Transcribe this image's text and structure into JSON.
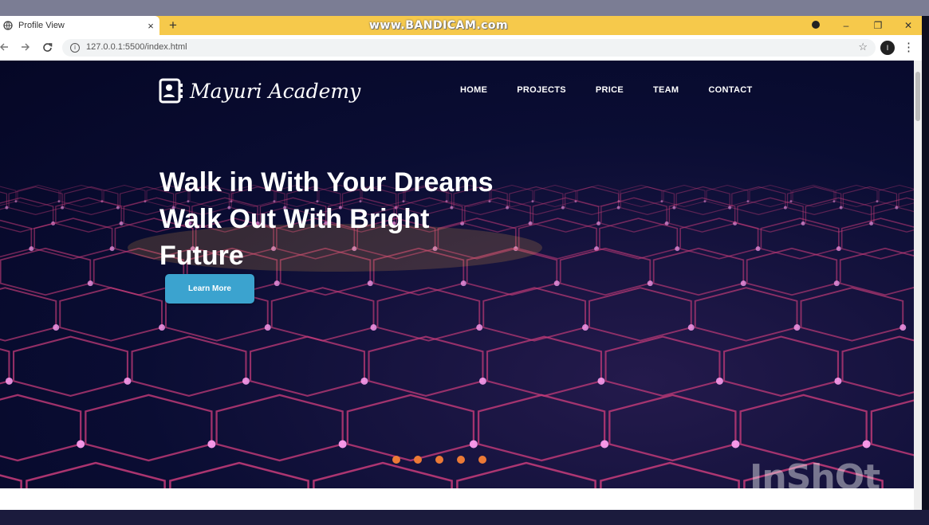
{
  "browser": {
    "tab_title": "Profile View",
    "tab_close": "×",
    "new_tab": "+",
    "url": "127.0.0.1:5500/index.html",
    "recorder_watermark": "www.BANDICAM.com",
    "window_controls": {
      "minimize": "–",
      "restore": "❐",
      "close": "✕"
    },
    "account_initial": "I",
    "menu": "⋮",
    "icons": {
      "back": "back-arrow-icon",
      "forward": "forward-arrow-icon",
      "reload": "reload-icon",
      "site_info": "info-icon",
      "bookmark": "star-icon",
      "menu": "menu-dots-icon"
    }
  },
  "site": {
    "logo_text": "Mayuri Academy",
    "nav": [
      "HOME",
      "PROJECTS",
      "PRICE",
      "TEAM",
      "CONTACT"
    ],
    "hero": {
      "line1": "Walk in With Your Dreams",
      "line2": "Walk Out With Bright",
      "line3": "Future",
      "cta": "Learn More"
    },
    "slider_dot_count": 5,
    "video_watermark": "InShOt"
  },
  "colors": {
    "tabbar": "#f6c94b",
    "cta": "#3ba3cf",
    "slider_dot": "#ec7a36",
    "hero_bg": "#0a0d33",
    "network_lines": "#c83c7a",
    "network_nodes": "#ff9ef0"
  }
}
